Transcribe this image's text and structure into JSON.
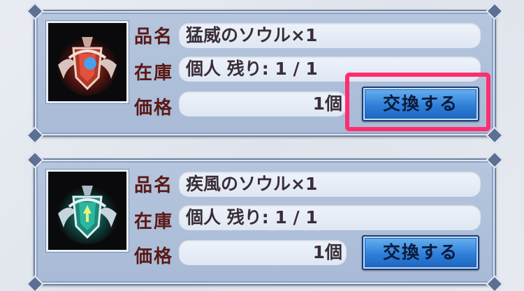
{
  "labels": {
    "name": "品名",
    "stock": "在庫",
    "price": "価格"
  },
  "items": [
    {
      "name_value": "猛威のソウル×1",
      "stock_value": "個人 残り: 1 / 1",
      "price_value": "1個",
      "exchange_label": "交換する",
      "icon": "red-soul-crest-icon",
      "accent": "#e04a3a"
    },
    {
      "name_value": "疾風のソウル×1",
      "stock_value": "個人 残り: 1 / 1",
      "price_value": "1個",
      "exchange_label": "交換する",
      "icon": "green-soul-crest-icon",
      "accent": "#2fd0b0"
    }
  ],
  "highlight_color": "#ff2d6f"
}
